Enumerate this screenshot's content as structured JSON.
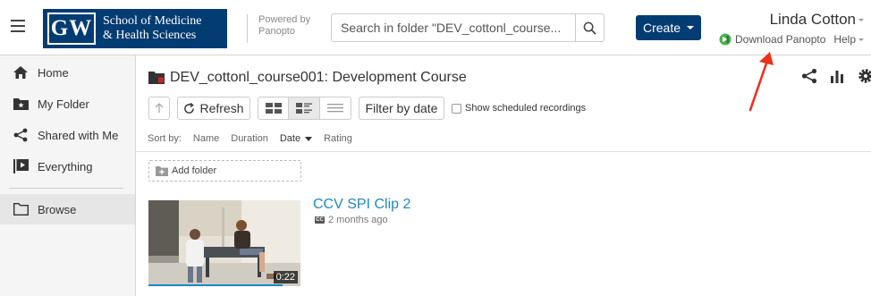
{
  "header": {
    "logo": {
      "mark": "GW",
      "line1": "School of Medicine",
      "line2": "& Health Sciences",
      "color": "#033c73"
    },
    "powered_by": {
      "line1": "Powered by",
      "line2": "Panopto"
    },
    "search": {
      "placeholder": "Search in folder \"DEV_cottonl_course...",
      "icon": "search-icon"
    },
    "create_label": "Create",
    "user_name": "Linda Cotton",
    "download_label": "Download Panopto",
    "help_label": "Help"
  },
  "sidebar": {
    "items": [
      {
        "label": "Home",
        "icon": "home-icon"
      },
      {
        "label": "My Folder",
        "icon": "my-folder-icon"
      },
      {
        "label": "Shared with Me",
        "icon": "share-icon"
      },
      {
        "label": "Everything",
        "icon": "everything-icon"
      },
      {
        "label": "Browse",
        "icon": "browse-folder-icon"
      }
    ]
  },
  "main": {
    "folder_title": "DEV_cottonl_course001: Development Course",
    "toolbar": {
      "refresh_label": "Refresh",
      "filter_label": "Filter by date",
      "scheduled_label": "Show scheduled recordings"
    },
    "sort": {
      "prefix": "Sort by:",
      "options": [
        "Name",
        "Duration",
        "Date",
        "Rating"
      ],
      "active": "Date"
    },
    "add_folder_label": "Add folder",
    "videos": [
      {
        "title": "CCV SPI Clip 2",
        "age": "2 months ago",
        "duration": "0:22",
        "cc": "CC"
      }
    ]
  },
  "colors": {
    "brand": "#033c73",
    "link": "#1e88c6",
    "annotation": "#e8321e"
  }
}
